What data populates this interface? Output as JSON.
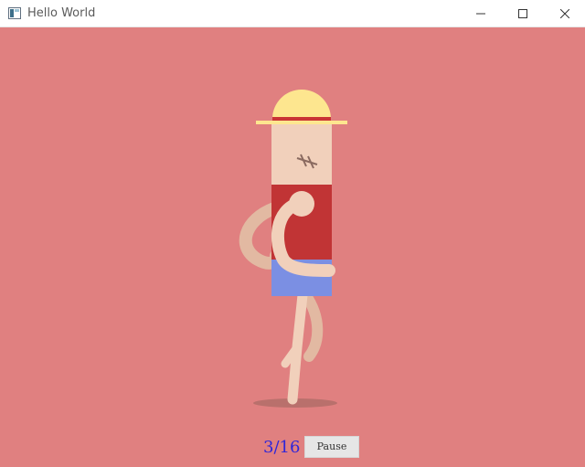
{
  "window": {
    "title": "Hello World"
  },
  "controls": {
    "minimize_icon": "minimize-icon",
    "maximize_icon": "maximize-icon",
    "close_icon": "close-icon"
  },
  "scene": {
    "frame_counter": "3/16",
    "pause_label": "Pause",
    "colors": {
      "background": "#e08080",
      "hat": "#fde68f",
      "hat_band": "#c93434",
      "skin": "#f1d0bb",
      "shirt": "#c13435",
      "shorts": "#7b8fe3",
      "counter": "#2f25d8"
    }
  }
}
